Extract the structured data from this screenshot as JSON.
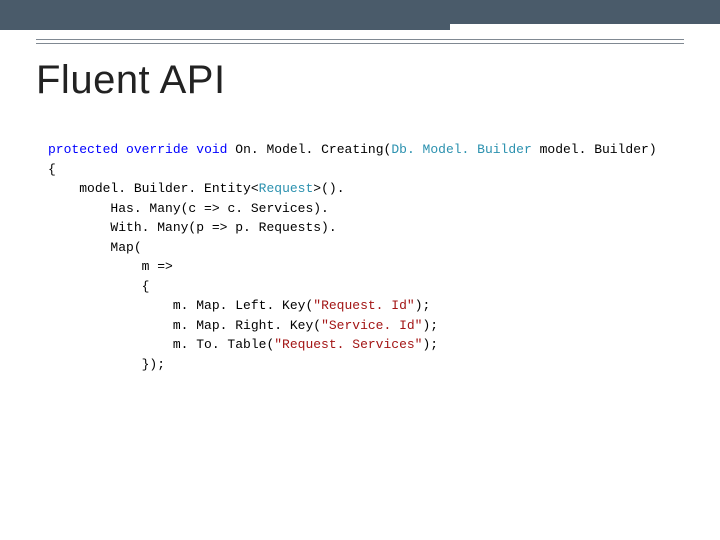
{
  "title": "Fluent API",
  "code": {
    "kw_protected": "protected",
    "kw_override": "override",
    "kw_void": "void",
    "method": "On. Model. Creating",
    "paramType": "Db. Model. Builder",
    "paramName": "model. Builder",
    "l1a": "model. Builder. Entity",
    "entityType": "Request",
    "l1b": "().",
    "l2": "Has. Many(c => c. Services).",
    "l3": "With. Many(p => p. Requests).",
    "l4": "Map(",
    "l5": "m =>",
    "l6": "{",
    "l7a": "m. Map. Left. Key(",
    "str1": "\"Request. Id\"",
    "l7b": ");",
    "l8a": "m. Map. Right. Key(",
    "str2": "\"Service. Id\"",
    "l8b": ");",
    "l9a": "m. To. Table(",
    "str3": "\"Request. Services\"",
    "l9b": ");",
    "l10": "});"
  }
}
